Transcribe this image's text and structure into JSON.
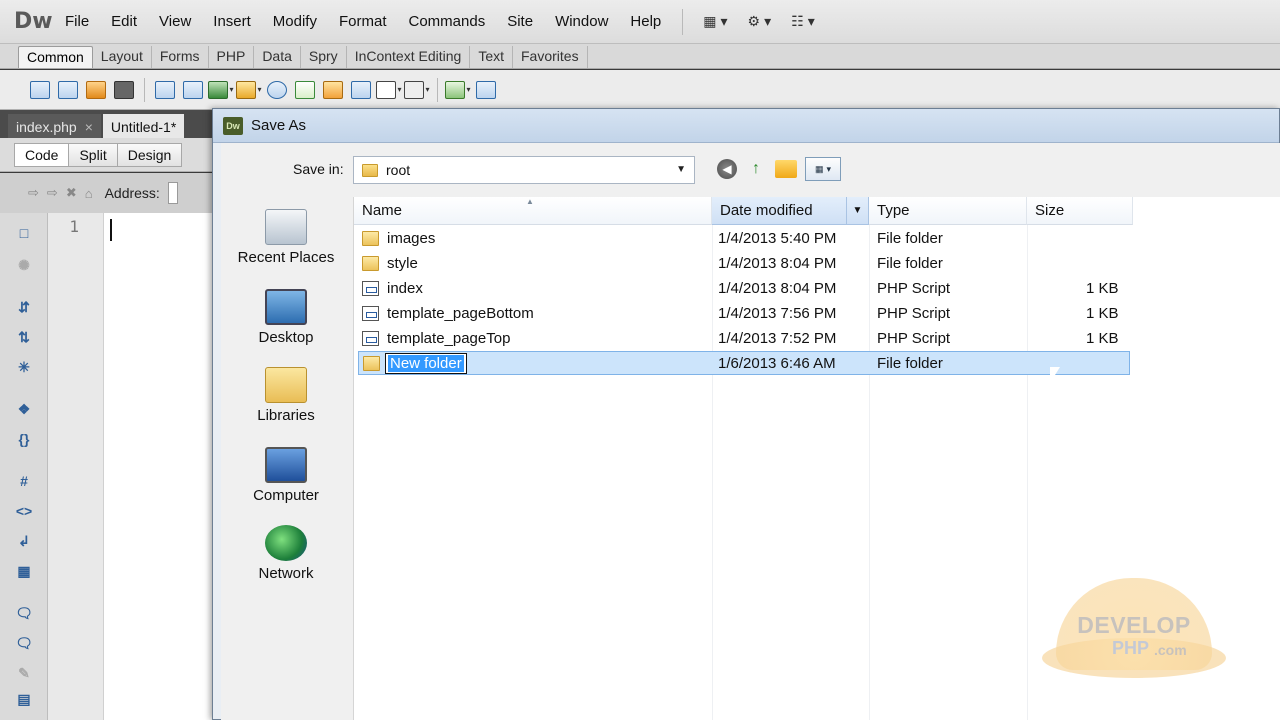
{
  "app": {
    "logo": "Dw",
    "menu": [
      "File",
      "Edit",
      "View",
      "Insert",
      "Modify",
      "Format",
      "Commands",
      "Site",
      "Window",
      "Help"
    ]
  },
  "insert_tabs": [
    "Common",
    "Layout",
    "Forms",
    "PHP",
    "Data",
    "Spry",
    "InContext Editing",
    "Text",
    "Favorites"
  ],
  "documents": {
    "tabs": [
      {
        "label": "index.php",
        "close": "×"
      },
      {
        "label": "Untitled-1*"
      }
    ],
    "view_buttons": [
      "Code",
      "Split",
      "Design"
    ],
    "address_label": "Address:",
    "line_number": "1"
  },
  "dialog": {
    "title": "Save As",
    "icon_text": "Dw",
    "save_in_label": "Save in:",
    "save_in_value": "root",
    "places": [
      "Recent Places",
      "Desktop",
      "Libraries",
      "Computer",
      "Network"
    ],
    "columns": [
      "Name",
      "Date modified",
      "Type",
      "Size"
    ],
    "files": [
      {
        "name": "images",
        "date": "1/4/2013 5:40 PM",
        "type": "File folder",
        "size": "",
        "kind": "folder"
      },
      {
        "name": "style",
        "date": "1/4/2013 8:04 PM",
        "type": "File folder",
        "size": "",
        "kind": "folder"
      },
      {
        "name": "index",
        "date": "1/4/2013 8:04 PM",
        "type": "PHP Script",
        "size": "1 KB",
        "kind": "php"
      },
      {
        "name": "template_pageBottom",
        "date": "1/4/2013 7:56 PM",
        "type": "PHP Script",
        "size": "1 KB",
        "kind": "php"
      },
      {
        "name": "template_pageTop",
        "date": "1/4/2013 7:52 PM",
        "type": "PHP Script",
        "size": "1 KB",
        "kind": "php"
      }
    ],
    "new_folder": {
      "name": "New folder",
      "date": "1/6/2013 6:46 AM",
      "type": "File folder"
    }
  },
  "watermark": {
    "line1": "DEVELOP",
    "line2": "PHP",
    "line3": ".com"
  },
  "colors": {
    "selection": "#cce4fb",
    "rename_highlight": "#3399ff",
    "title_bar": "#c2d4e9"
  }
}
